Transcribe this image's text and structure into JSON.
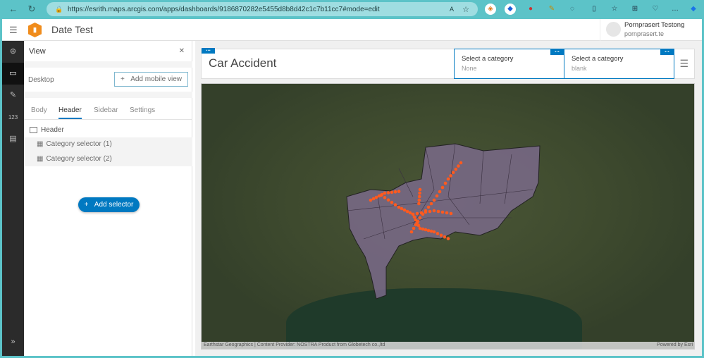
{
  "browser": {
    "url": "https://esrith.maps.arcgis.com/apps/dashboards/9186870282e5455d8b8d42c1c7b11cc7#mode=edit"
  },
  "app": {
    "title": "Date Test",
    "user_name": "Pornprasert Testong",
    "user_login": "pornprasert.te"
  },
  "panel": {
    "title": "View",
    "view_label": "Desktop",
    "add_mobile": "Add mobile view",
    "tabs": [
      "Body",
      "Header",
      "Sidebar",
      "Settings"
    ],
    "active_tab": "Header",
    "tree_root": "Header",
    "tree_items": [
      "Category selector (1)",
      "Category selector (2)"
    ],
    "add_selector": "Add selector"
  },
  "dashboard": {
    "title": "Car Accident",
    "selectors": [
      {
        "label": "Select a category",
        "value": "None"
      },
      {
        "label": "Select a category",
        "value": "blank"
      }
    ]
  },
  "map": {
    "attribution": "Earthstar Geographics | Content Provider: NOSTRA Product from Globetech co.,ltd",
    "powered": "Powered by Esri"
  },
  "colors": {
    "accent": "#0079c1",
    "frame": "#5cc3c8",
    "points": "#ff5a1f",
    "districts": "#7a6a8a"
  }
}
